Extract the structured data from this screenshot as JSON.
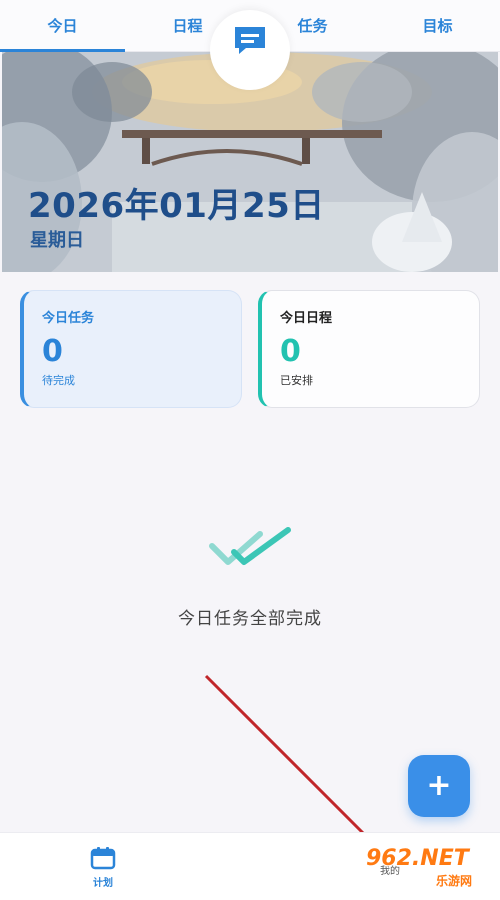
{
  "tabs": [
    {
      "label": "今日",
      "active": true
    },
    {
      "label": "日程",
      "active": false
    },
    {
      "label": "任务",
      "active": false
    },
    {
      "label": "目标",
      "active": false
    }
  ],
  "hero": {
    "date": "2026年01月25日",
    "weekday": "星期日"
  },
  "cards": {
    "tasks": {
      "title": "今日任务",
      "count": "0",
      "sub": "待完成"
    },
    "schedule": {
      "title": "今日日程",
      "count": "0",
      "sub": "已安排"
    }
  },
  "empty_state": {
    "text": "今日任务全部完成",
    "icon": "double-check-icon"
  },
  "fab": {
    "label": "+"
  },
  "bottom_nav": {
    "plan_label": "计划",
    "plan_icon": "calendar-icon",
    "center_icon": "message-icon",
    "mine_label": "我的"
  },
  "watermark": {
    "logo": "962.NET",
    "sub": "乐游网"
  },
  "colors": {
    "accent": "#2b84d8",
    "teal": "#22c2b0",
    "fab": "#3a8fe8"
  }
}
